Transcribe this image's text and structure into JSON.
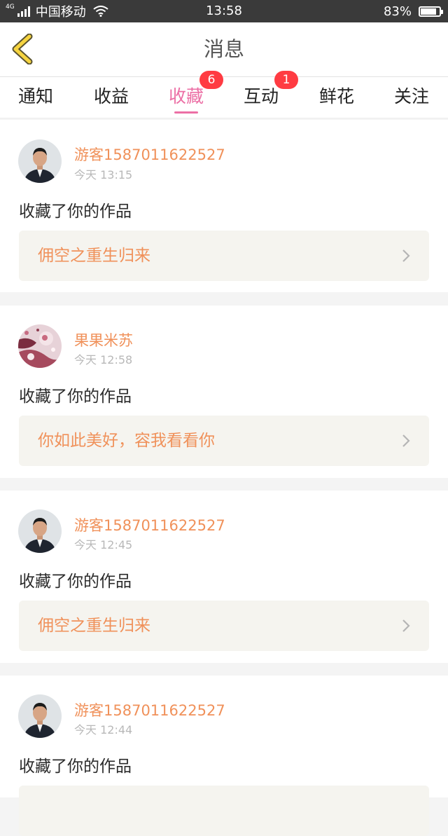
{
  "status_bar": {
    "network": "4G",
    "carrier": "中国移动",
    "time": "13:58",
    "battery": "83%",
    "battery_level": 0.83
  },
  "header": {
    "back_icon": "chevron-left-icon",
    "title": "消息"
  },
  "tabs": [
    {
      "label": "通知",
      "active": false,
      "badge": ""
    },
    {
      "label": "收益",
      "active": false,
      "badge": ""
    },
    {
      "label": "收藏",
      "active": true,
      "badge": "6"
    },
    {
      "label": "互动",
      "active": false,
      "badge": "1"
    },
    {
      "label": "鲜花",
      "active": false,
      "badge": ""
    },
    {
      "label": "关注",
      "active": false,
      "badge": ""
    }
  ],
  "messages": [
    {
      "user": "游客1587011622527",
      "time": "今天 13:15",
      "action": "收藏了你的作品",
      "work": "佣空之重生归来",
      "avatar": "man-portrait"
    },
    {
      "user": "果果米苏",
      "time": "今天 12:58",
      "action": "收藏了你的作品",
      "work": "你如此美好，容我看看你",
      "avatar": "floral-photo"
    },
    {
      "user": "游客1587011622527",
      "time": "今天 12:45",
      "action": "收藏了你的作品",
      "work": "佣空之重生归来",
      "avatar": "man-portrait"
    },
    {
      "user": "游客1587011622527",
      "time": "今天 12:44",
      "action": "收藏了你的作品",
      "work": "",
      "avatar": "man-portrait"
    }
  ],
  "colors": {
    "accent_pink": "#ec6fa5",
    "username_orange": "#f0915a",
    "badge_red": "#ff3b42",
    "back_yellow": "#f6d440"
  }
}
